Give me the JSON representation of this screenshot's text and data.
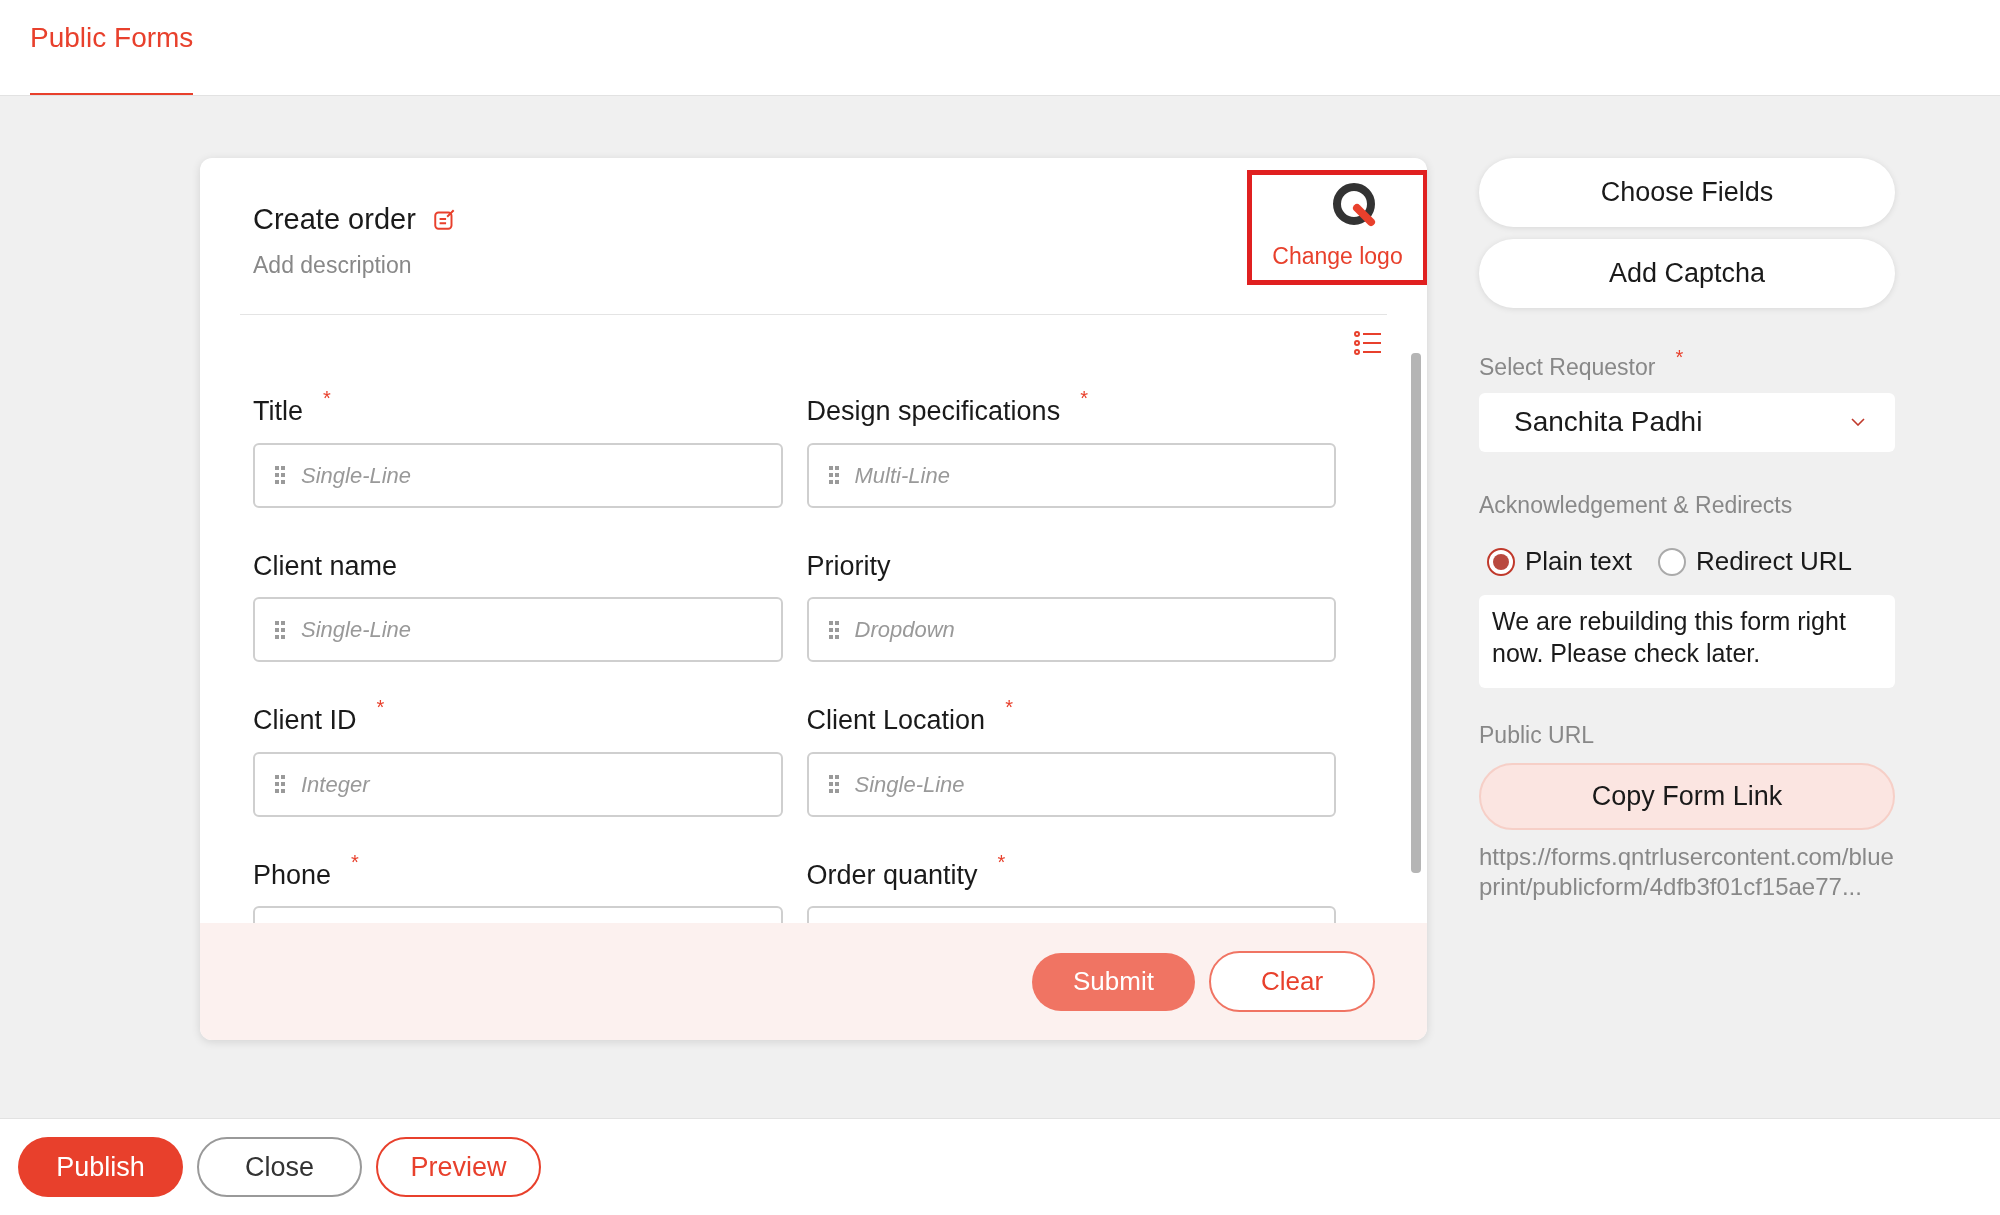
{
  "required_mark": "*",
  "header": {
    "tabs": [
      {
        "label": "Public Forms",
        "selected": true
      }
    ]
  },
  "form": {
    "title": "Create order",
    "description": "Add description",
    "logo_label": "Change logo",
    "fields": [
      {
        "label": "Title",
        "required": true,
        "placeholder": "Single-Line"
      },
      {
        "label": "Design specifications",
        "required": true,
        "placeholder": "Multi-Line"
      },
      {
        "label": "Client name",
        "required": false,
        "placeholder": "Single-Line"
      },
      {
        "label": "Priority",
        "required": false,
        "placeholder": "Dropdown"
      },
      {
        "label": "Client ID",
        "required": true,
        "placeholder": "Integer"
      },
      {
        "label": "Client Location",
        "required": true,
        "placeholder": "Single-Line"
      },
      {
        "label": "Phone",
        "required": true
      },
      {
        "label": "Order quantity",
        "required": true
      }
    ],
    "buttons": [
      {
        "label": "Submit",
        "kind": "filled"
      },
      {
        "label": "Clear",
        "kind": "outline"
      }
    ]
  },
  "side": {
    "buttons": [
      "Choose Fields",
      "Add Captcha"
    ],
    "requestor": {
      "label": "Select Requestor",
      "required": true,
      "value": "Sanchita Padhi"
    },
    "ack": {
      "label": "Acknowledgement & Redirects",
      "options": [
        {
          "label": "Plain text",
          "selected": true
        },
        {
          "label": "Redirect URL",
          "selected": false
        }
      ],
      "message": "We are rebuilding this form right now. Please check later."
    },
    "public_url": {
      "label": "Public URL",
      "button": "Copy Form Link",
      "url": "https://forms.qntrlusercontent.com/blueprint/publicform/4dfb3f01cf15ae77..."
    }
  },
  "footer": {
    "buttons": [
      {
        "label": "Publish",
        "kind": "filled"
      },
      {
        "label": "Close",
        "kind": "neutral"
      },
      {
        "label": "Preview",
        "kind": "outline"
      }
    ]
  }
}
